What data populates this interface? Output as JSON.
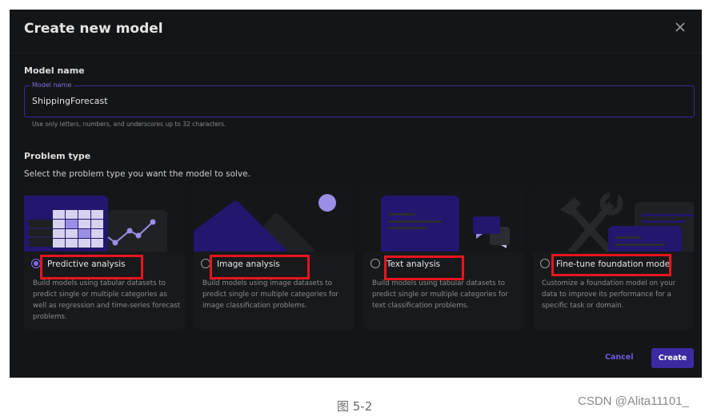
{
  "dialog": {
    "title": "Create new model",
    "close_icon": "close-icon"
  },
  "model_name": {
    "section_label": "Model name",
    "field_label": "Model name",
    "value": "ShippingForecast",
    "hint": "Use only letters, numbers, and underscores up to 32 characters."
  },
  "problem_type": {
    "section_label": "Problem type",
    "subtitle": "Select the problem type you want the model to solve.",
    "selected": "Predictive analysis",
    "options": [
      {
        "title": "Predictive analysis",
        "description": "Build models using tabular datasets to predict single or multiple categories as well as regression and time-series forecast problems.",
        "checked": true,
        "illustration": "table-chart-illustration"
      },
      {
        "title": "Image analysis",
        "description": "Build models using image datasets to predict single or multiple categories for image classification problems.",
        "checked": false,
        "illustration": "mountain-image-illustration"
      },
      {
        "title": "Text analysis",
        "description": "Build models using tabular datasets to predict single or multiple categories for text classification problems.",
        "checked": false,
        "illustration": "text-chat-illustration"
      },
      {
        "title": "Fine-tune foundation model",
        "description": "Customize a foundation model on your data to improve its performance for a specific task or domain.",
        "checked": false,
        "illustration": "tools-document-illustration"
      }
    ]
  },
  "footer": {
    "cancel_label": "Cancel",
    "create_label": "Create"
  },
  "colors": {
    "accent": "#7b6cf0",
    "primary_button": "#3a2ba3",
    "illustration_dark": "#22166e",
    "illustration_light": "#9b8ee6",
    "annotation": "#e8141e"
  },
  "page_caption": "图 5-2",
  "watermark": "CSDN @Alita11101_"
}
